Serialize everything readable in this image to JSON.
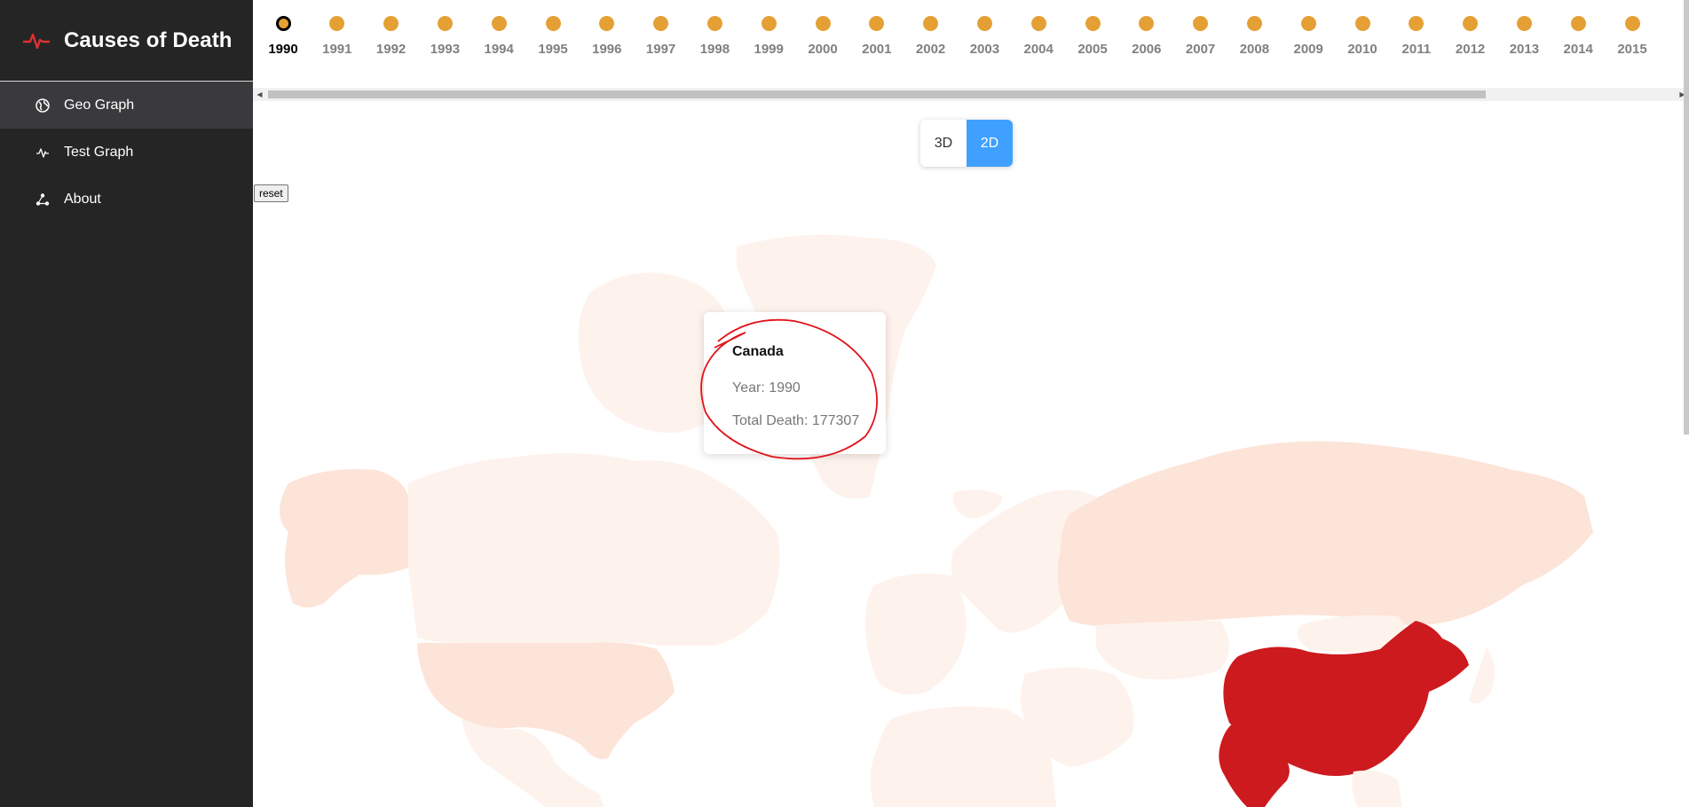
{
  "app": {
    "title": "Causes of Death"
  },
  "sidebar": {
    "items": [
      {
        "label": "Geo Graph",
        "icon": "globe-icon",
        "active": true
      },
      {
        "label": "Test Graph",
        "icon": "pulse-icon",
        "active": false
      },
      {
        "label": "About",
        "icon": "share-icon",
        "active": false
      }
    ]
  },
  "timeline": {
    "selected": "1990",
    "years": [
      "1990",
      "1991",
      "1992",
      "1993",
      "1994",
      "1995",
      "1996",
      "1997",
      "1998",
      "1999",
      "2000",
      "2001",
      "2002",
      "2003",
      "2004",
      "2005",
      "2006",
      "2007",
      "2008",
      "2009",
      "2010",
      "2011",
      "2012",
      "2013",
      "2014",
      "2015"
    ]
  },
  "view_toggle": {
    "option_3d": "3D",
    "option_2d": "2D",
    "selected": "2D"
  },
  "reset": {
    "label": "reset"
  },
  "tooltip": {
    "country": "Canada",
    "year_line": "Year: 1990",
    "death_line": "Total Death: 177307"
  },
  "colors": {
    "sidebar_bg": "#252525",
    "accent_red": "#e03030",
    "timeline_dot": "#e5a035",
    "toggle_active": "#3fa0ff",
    "map_high": "#cc1a1f",
    "map_low": "#fde4d8",
    "map_lowest": "#fef2ec"
  }
}
